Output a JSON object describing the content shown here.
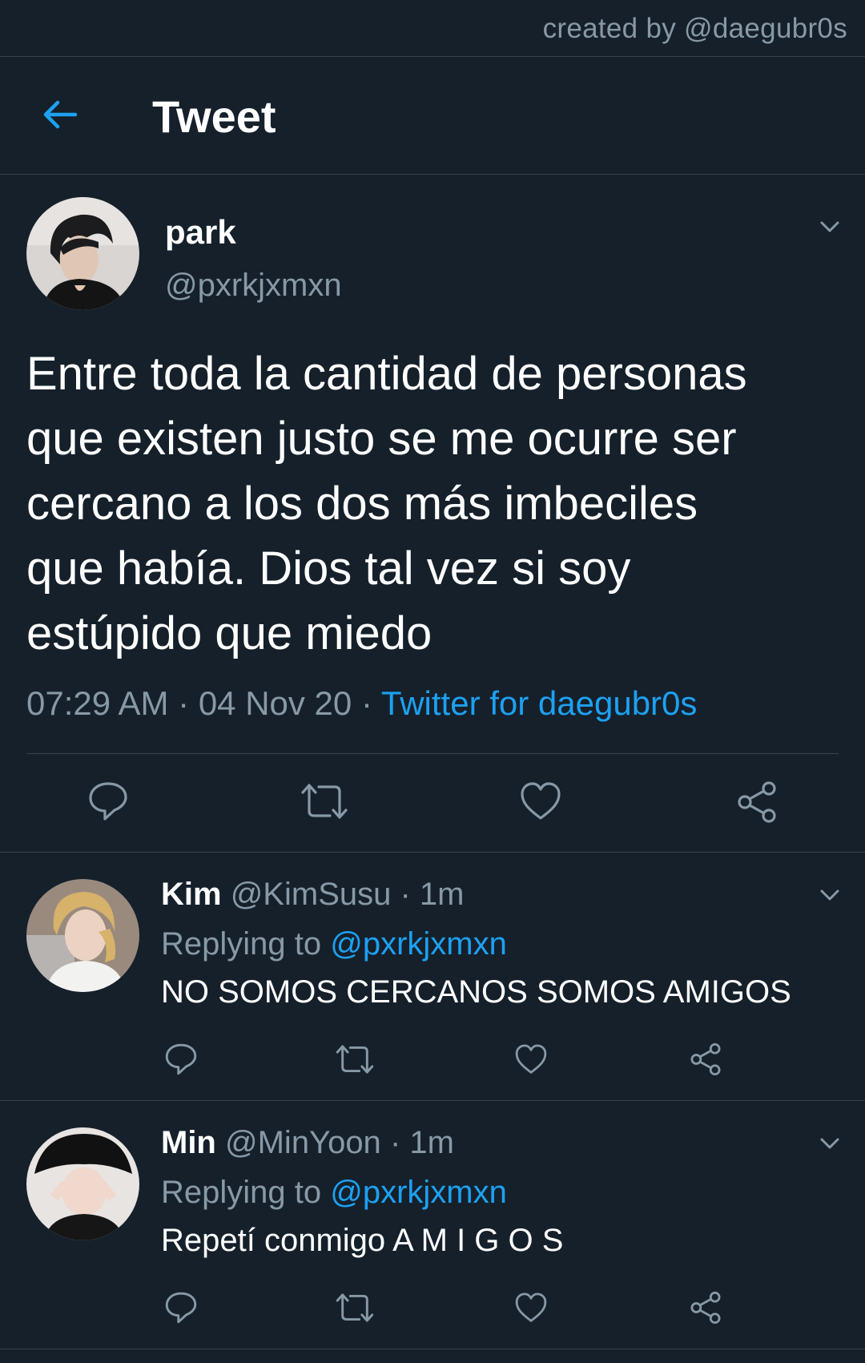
{
  "credit": "created by @daegubr0s",
  "header": {
    "title": "Tweet",
    "back_icon": "arrow-left-icon"
  },
  "colors": {
    "background": "#15202b",
    "border": "#38444d",
    "secondary_text": "#8899a6",
    "accent": "#1da1f2"
  },
  "main_tweet": {
    "name": "park",
    "handle": "@pxrkjxmxn",
    "text": "Entre toda la cantidad de personas\nque existen justo se me ocurre ser\ncercano a los dos más imbeciles\nque había. Dios tal vez si soy\nestúpido que miedo",
    "time": "07:29 AM",
    "date": "04 Nov 20",
    "source": "Twitter for daegubr0s",
    "separator": "·",
    "actions": [
      "reply-icon",
      "retweet-icon",
      "like-icon",
      "share-icon"
    ]
  },
  "replies": [
    {
      "name": "Kim",
      "handle": "@KimSusu",
      "time": "· 1m",
      "replying_label": "Replying to",
      "replying_to": "@pxrkjxmxn",
      "text": "NO SOMOS CERCANOS SOMOS AMIGOS"
    },
    {
      "name": "Min",
      "handle": "@MinYoon",
      "time": "· 1m",
      "replying_label": "Replying to",
      "replying_to": "@pxrkjxmxn",
      "text": "Repetí conmigo A M I G O S"
    }
  ]
}
